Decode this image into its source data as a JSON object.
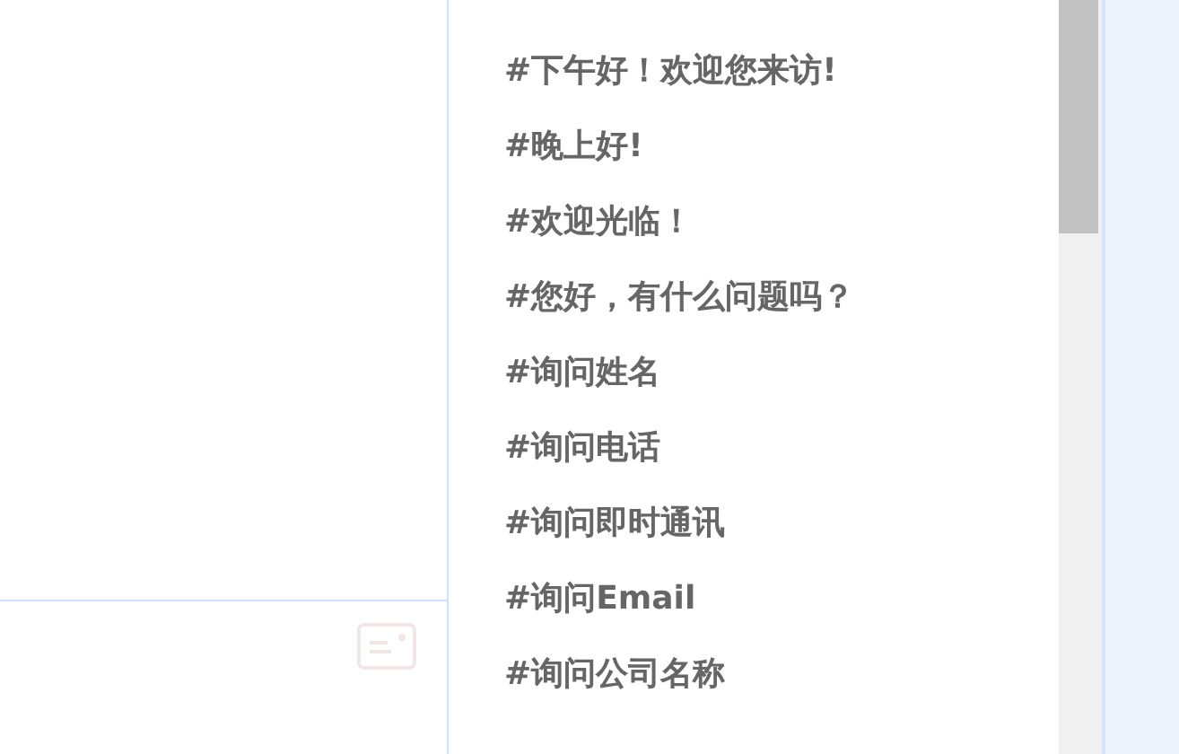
{
  "quick_replies": [
    {
      "text": "#下午好！欢迎您来访!"
    },
    {
      "text": "#晚上好!"
    },
    {
      "text": "#欢迎光临！"
    },
    {
      "text": "#您好，有什么问题吗？"
    },
    {
      "text": "#询问姓名"
    },
    {
      "text": "#询问电话"
    },
    {
      "text": "#询问即时通讯"
    },
    {
      "text": "#询问Email"
    },
    {
      "text": "#询问公司名称"
    }
  ]
}
